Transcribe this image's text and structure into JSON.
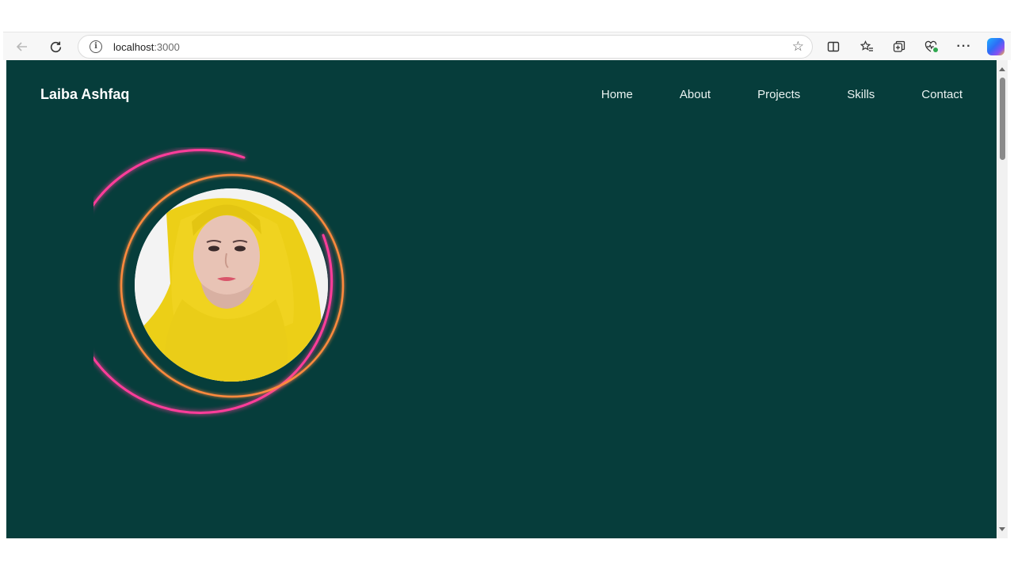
{
  "browser": {
    "url_host": "localhost",
    "url_port": ":3000",
    "icons": [
      "back-arrow-icon",
      "reload-icon",
      "site-info-icon",
      "favorite-star-icon",
      "split-screen-icon",
      "favorites-icon",
      "collections-icon",
      "browser-essentials-icon",
      "more-icon",
      "copilot-icon"
    ],
    "more_label": "···"
  },
  "page": {
    "brand": "Laiba Ashfaq",
    "nav": [
      "Home",
      "About",
      "Projects",
      "Skills",
      "Contact"
    ],
    "colors": {
      "background": "#063d3b",
      "outer_ring": "#ff3d9a",
      "inner_ring": "#ff8a3d",
      "headscarf": "#f2d21a"
    }
  }
}
